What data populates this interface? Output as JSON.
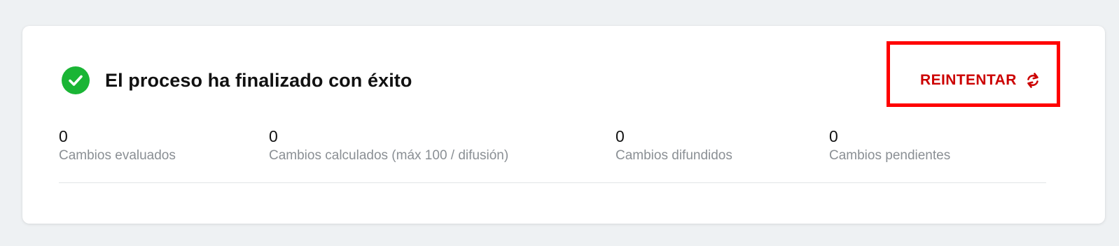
{
  "status": {
    "title": "El proceso ha finalizado con éxito",
    "icon": "check-circle-icon",
    "color": "#1ab535"
  },
  "actions": {
    "retry_label": "REINTENTAR",
    "retry_icon": "refresh-icon",
    "retry_color": "#cc0000",
    "highlight_color": "#ff0000"
  },
  "stats": [
    {
      "value": "0",
      "label": "Cambios evaluados"
    },
    {
      "value": "0",
      "label": "Cambios calculados (máx 100 / difusión)"
    },
    {
      "value": "0",
      "label": "Cambios difundidos"
    },
    {
      "value": "0",
      "label": "Cambios pendientes"
    }
  ]
}
